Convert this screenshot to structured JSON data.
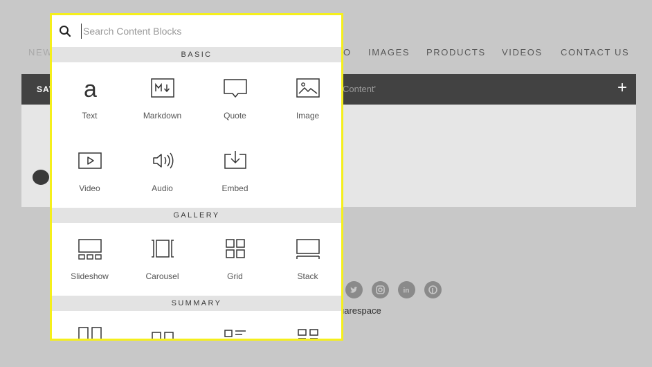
{
  "site_nav": {
    "items": [
      {
        "label": "NEW",
        "dim": true
      },
      {
        "label": "O",
        "dim": false
      },
      {
        "label": "IMAGES",
        "dim": false
      },
      {
        "label": "PRODUCTS",
        "dim": false
      },
      {
        "label": "VIDEOS",
        "dim": false
      },
      {
        "label": "CONTACT US",
        "dim": false
      }
    ]
  },
  "edit_bar": {
    "save_label": "SAV",
    "hint": "Content'",
    "add_label": "+"
  },
  "footer": {
    "text": "uarespace",
    "social_icons": [
      "twitter-icon",
      "instagram-icon",
      "linkedin-icon",
      "pinterest-icon"
    ]
  },
  "search": {
    "placeholder": "Search Content Blocks",
    "value": ""
  },
  "sections": [
    {
      "title": "BASIC"
    },
    {
      "title": "GALLERY"
    },
    {
      "title": "SUMMARY"
    }
  ],
  "basic_blocks": [
    {
      "label": "Text",
      "icon": "text-icon"
    },
    {
      "label": "Markdown",
      "icon": "markdown-icon"
    },
    {
      "label": "Quote",
      "icon": "quote-icon"
    },
    {
      "label": "Image",
      "icon": "image-icon"
    },
    {
      "label": "Video",
      "icon": "video-icon"
    },
    {
      "label": "Audio",
      "icon": "audio-icon"
    },
    {
      "label": "Embed",
      "icon": "embed-icon"
    }
  ],
  "gallery_blocks": [
    {
      "label": "Slideshow",
      "icon": "slideshow-icon"
    },
    {
      "label": "Carousel",
      "icon": "carousel-icon"
    },
    {
      "label": "Grid",
      "icon": "grid-icon"
    },
    {
      "label": "Stack",
      "icon": "stack-icon"
    }
  ],
  "summary_blocks": [
    {
      "label": "",
      "icon": "summary-wall-icon"
    },
    {
      "label": "",
      "icon": "summary-carousel-icon"
    },
    {
      "label": "",
      "icon": "summary-list-icon"
    },
    {
      "label": "",
      "icon": "summary-grid-icon"
    }
  ],
  "colors": {
    "highlight_border": "#f5ef1c",
    "edit_bar": "#424242",
    "section_header": "#e3e3e3"
  }
}
